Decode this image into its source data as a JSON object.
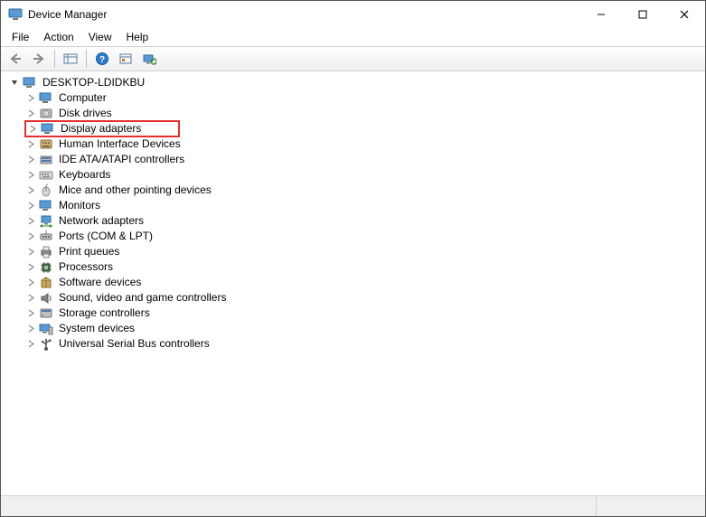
{
  "window": {
    "title": "Device Manager",
    "controls": {
      "minimize": "—",
      "maximize": "☐",
      "close": "✕"
    }
  },
  "menubar": {
    "file": "File",
    "action": "Action",
    "view": "View",
    "help": "Help"
  },
  "toolbar": {
    "back": "back-icon",
    "forward": "forward-icon",
    "show_hidden": "show-hidden-icon",
    "help": "help-icon",
    "properties": "properties-icon",
    "scan": "scan-icon"
  },
  "tree": {
    "root": {
      "label": "DESKTOP-LDIDKBU",
      "expanded": true,
      "icon": "computer-icon"
    },
    "children": [
      {
        "label": "Computer",
        "icon": "monitor-icon",
        "highlight": false
      },
      {
        "label": "Disk drives",
        "icon": "disk-icon",
        "highlight": false
      },
      {
        "label": "Display adapters",
        "icon": "monitor-icon",
        "highlight": true
      },
      {
        "label": "Human Interface Devices",
        "icon": "hid-icon",
        "highlight": false
      },
      {
        "label": "IDE ATA/ATAPI controllers",
        "icon": "ide-icon",
        "highlight": false
      },
      {
        "label": "Keyboards",
        "icon": "keyboard-icon",
        "highlight": false
      },
      {
        "label": "Mice and other pointing devices",
        "icon": "mouse-icon",
        "highlight": false
      },
      {
        "label": "Monitors",
        "icon": "monitor-icon",
        "highlight": false
      },
      {
        "label": "Network adapters",
        "icon": "network-icon",
        "highlight": false
      },
      {
        "label": "Ports (COM & LPT)",
        "icon": "port-icon",
        "highlight": false
      },
      {
        "label": "Print queues",
        "icon": "printer-icon",
        "highlight": false
      },
      {
        "label": "Processors",
        "icon": "cpu-icon",
        "highlight": false
      },
      {
        "label": "Software devices",
        "icon": "software-icon",
        "highlight": false
      },
      {
        "label": "Sound, video and game controllers",
        "icon": "sound-icon",
        "highlight": false
      },
      {
        "label": "Storage controllers",
        "icon": "storage-icon",
        "highlight": false
      },
      {
        "label": "System devices",
        "icon": "system-icon",
        "highlight": false
      },
      {
        "label": "Universal Serial Bus controllers",
        "icon": "usb-icon",
        "highlight": false
      }
    ]
  },
  "icons": {
    "computer-icon": "🖥",
    "monitor-icon": "🖥",
    "disk-icon": "💽",
    "hid-icon": "🎛",
    "ide-icon": "🖴",
    "keyboard-icon": "⌨",
    "mouse-icon": "🖱",
    "network-icon": "🖧",
    "port-icon": "🔌",
    "printer-icon": "🖨",
    "cpu-icon": "▦",
    "software-icon": "📦",
    "sound-icon": "🔊",
    "storage-icon": "🗄",
    "system-icon": "💻",
    "usb-icon": "ψ"
  }
}
